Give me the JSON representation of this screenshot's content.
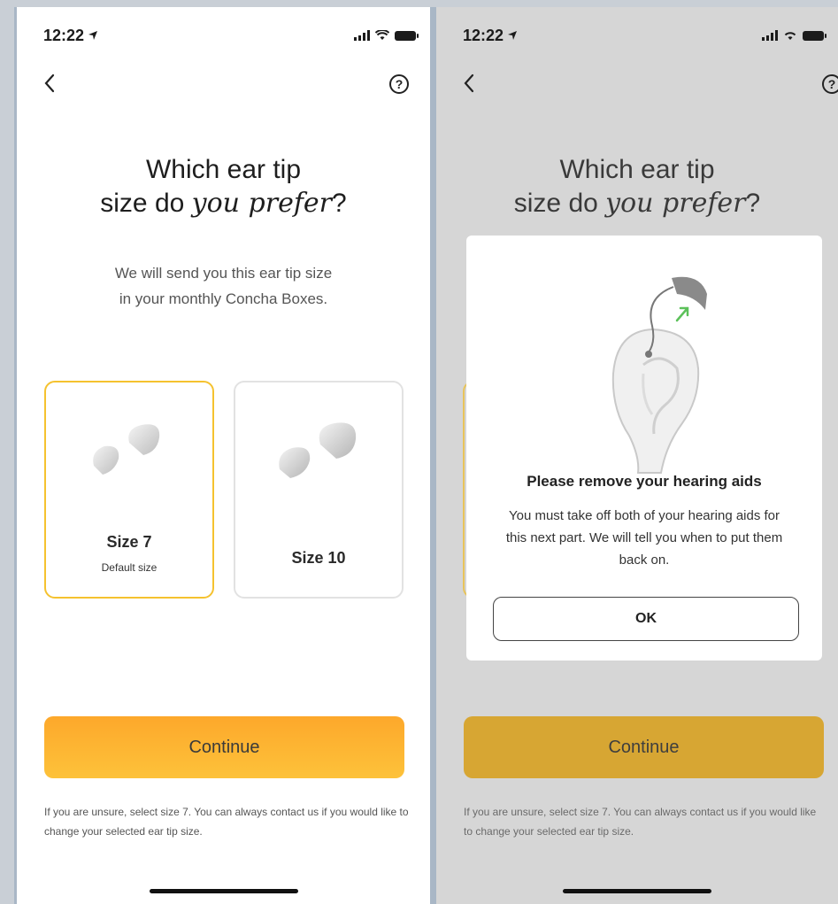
{
  "status_bar": {
    "time": "12:22"
  },
  "screen": {
    "title_line1": "Which ear tip",
    "title_line2_plain": "size do ",
    "title_line2_italic": "you prefer",
    "title_line2_end": "?",
    "subtitle_line1": "We will send you this ear tip size",
    "subtitle_line2": "in your monthly Concha Boxes.",
    "options": [
      {
        "label": "Size 7",
        "sublabel": "Default size",
        "selected": true
      },
      {
        "label": "Size 10",
        "sublabel": "",
        "selected": false
      }
    ],
    "continue_label": "Continue",
    "footnote": "If you are unsure, select size 7. You can always contact us if you would like to change your selected ear tip size.",
    "help_icon_label": "?"
  },
  "modal": {
    "title": "Please remove your hearing aids",
    "body": "You must take off both of your hearing aids for this next part. We will tell you when to put them back on.",
    "ok_label": "OK"
  },
  "colors": {
    "accent": "#fdb02f",
    "selected_border": "#f5c22f",
    "arrow_green": "#5cc15a"
  },
  "icons": [
    "back-chevron-icon",
    "help-icon",
    "location-arrow-icon",
    "signal-icon",
    "wifi-icon",
    "battery-icon"
  ]
}
